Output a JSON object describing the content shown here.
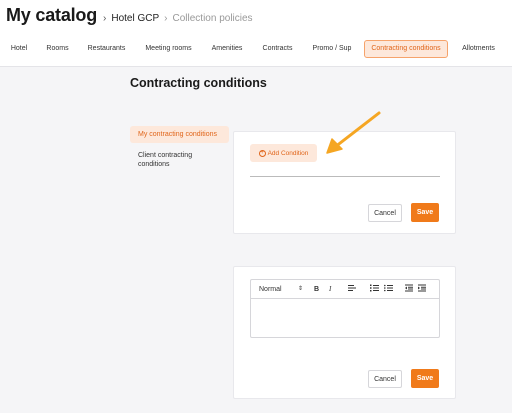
{
  "header": {
    "app_title": "My catalog",
    "breadcrumb": {
      "separator": "›",
      "hotel": "Hotel GCP",
      "current": "Collection policies"
    }
  },
  "tabs": [
    {
      "label": "Hotel"
    },
    {
      "label": "Rooms"
    },
    {
      "label": "Restaurants"
    },
    {
      "label": "Meeting rooms"
    },
    {
      "label": "Amenities"
    },
    {
      "label": "Contracts"
    },
    {
      "label": "Promo / Sup"
    },
    {
      "label": "Contracting conditions",
      "active": true
    },
    {
      "label": "Allotments"
    }
  ],
  "main": {
    "section_title": "Contracting conditions",
    "side_nav": [
      {
        "label": "My contracting conditions",
        "active": true
      },
      {
        "label": "Client contracting conditions"
      }
    ],
    "conditions_card": {
      "add_label": "Add Condition",
      "add_icon": "plus-circle-icon",
      "cancel_label": "Cancel",
      "save_label": "Save"
    },
    "editor_card": {
      "format_select": "Normal",
      "bold": "B",
      "italic": "I",
      "cancel_label": "Cancel",
      "save_label": "Save"
    }
  },
  "colors": {
    "accent": "#f07a1a",
    "accent_soft": "#fde8db",
    "accent_text": "#e0651a",
    "annotation_arrow": "#f5a623"
  }
}
